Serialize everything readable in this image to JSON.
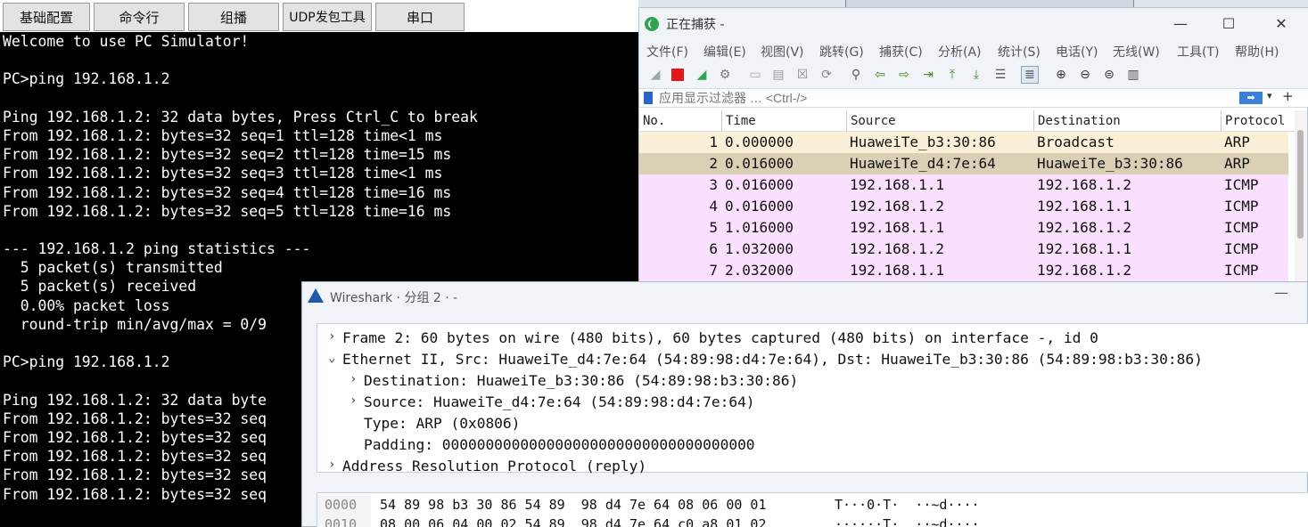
{
  "simulator": {
    "tabs": [
      "基础配置",
      "命令行",
      "组播",
      "UDP发包工具",
      "串口"
    ],
    "terminal_lines": [
      "Welcome to use PC Simulator!",
      "",
      "PC>ping 192.168.1.2",
      "",
      "Ping 192.168.1.2: 32 data bytes, Press Ctrl_C to break",
      "From 192.168.1.2: bytes=32 seq=1 ttl=128 time<1 ms",
      "From 192.168.1.2: bytes=32 seq=2 ttl=128 time=15 ms",
      "From 192.168.1.2: bytes=32 seq=3 ttl=128 time<1 ms",
      "From 192.168.1.2: bytes=32 seq=4 ttl=128 time=16 ms",
      "From 192.168.1.2: bytes=32 seq=5 ttl=128 time=16 ms",
      "",
      "--- 192.168.1.2 ping statistics ---",
      "  5 packet(s) transmitted",
      "  5 packet(s) received",
      "  0.00% packet loss",
      "  round-trip min/avg/max = 0/9",
      "",
      "PC>ping 192.168.1.2",
      "",
      "Ping 192.168.1.2: 32 data byte",
      "From 192.168.1.2: bytes=32 seq",
      "From 192.168.1.2: bytes=32 seq",
      "From 192.168.1.2: bytes=32 seq",
      "From 192.168.1.2: bytes=32 seq",
      "From 192.168.1.2: bytes=32 seq"
    ]
  },
  "wireshark": {
    "title": "正在捕获 -",
    "menu": [
      "文件(F)",
      "编辑(E)",
      "视图(V)",
      "跳转(G)",
      "捕获(C)",
      "分析(A)",
      "统计(S)",
      "电话(Y)",
      "无线(W)",
      "工具(T)",
      "帮助(H)"
    ],
    "filter_placeholder": "应用显示过滤器 … <Ctrl-/>",
    "columns": [
      "No.",
      "Time",
      "Source",
      "Destination",
      "Protocol"
    ],
    "packets": [
      {
        "no": "1",
        "time": "0.000000",
        "src": "HuaweiTe_b3:30:86",
        "dst": "Broadcast",
        "proto": "ARP"
      },
      {
        "no": "2",
        "time": "0.016000",
        "src": "HuaweiTe_d4:7e:64",
        "dst": "HuaweiTe_b3:30:86",
        "proto": "ARP"
      },
      {
        "no": "3",
        "time": "0.016000",
        "src": "192.168.1.1",
        "dst": "192.168.1.2",
        "proto": "ICMP"
      },
      {
        "no": "4",
        "time": "0.016000",
        "src": "192.168.1.2",
        "dst": "192.168.1.1",
        "proto": "ICMP"
      },
      {
        "no": "5",
        "time": "1.016000",
        "src": "192.168.1.1",
        "dst": "192.168.1.2",
        "proto": "ICMP"
      },
      {
        "no": "6",
        "time": "1.032000",
        "src": "192.168.1.2",
        "dst": "192.168.1.1",
        "proto": "ICMP"
      },
      {
        "no": "7",
        "time": "2.032000",
        "src": "192.168.1.1",
        "dst": "192.168.1.2",
        "proto": "ICMP"
      }
    ],
    "colors": {
      "arp": "#faf0d7",
      "arp_selected": "#dad0b6",
      "icmp": "#fce0ff"
    }
  },
  "detail": {
    "title": "Wireshark · 分组 2 · -",
    "tree": [
      {
        "arrow": "›",
        "indent": 0,
        "text": "Frame 2: 60 bytes on wire (480 bits), 60 bytes captured (480 bits) on interface -, id 0"
      },
      {
        "arrow": "⌄",
        "indent": 0,
        "text": "Ethernet II, Src: HuaweiTe_d4:7e:64 (54:89:98:d4:7e:64), Dst: HuaweiTe_b3:30:86 (54:89:98:b3:30:86)"
      },
      {
        "arrow": "›",
        "indent": 1,
        "text": "Destination: HuaweiTe_b3:30:86 (54:89:98:b3:30:86)"
      },
      {
        "arrow": "›",
        "indent": 1,
        "text": "Source: HuaweiTe_d4:7e:64 (54:89:98:d4:7e:64)"
      },
      {
        "arrow": "",
        "indent": 1,
        "text": "Type: ARP (0x0806)"
      },
      {
        "arrow": "",
        "indent": 1,
        "text": "Padding: 000000000000000000000000000000000000"
      },
      {
        "arrow": "›",
        "indent": 0,
        "text": "Address Resolution Protocol (reply)"
      }
    ],
    "hex": [
      {
        "offset": "0000",
        "bytes": "54 89 98 b3 30 86 54 89  98 d4 7e 64 08 06 00 01",
        "ascii": "T···0·T·  ··~d····"
      },
      {
        "offset": "0010",
        "bytes": "08 00 06 04 00 02 54 89  98 d4 7e 64 c0 a8 01 02",
        "ascii": "······T·  ··~d····"
      }
    ]
  }
}
